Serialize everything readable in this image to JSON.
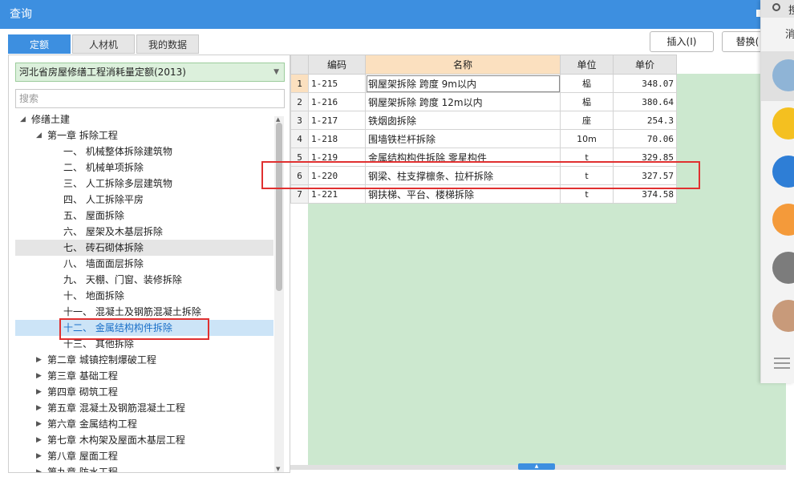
{
  "window": {
    "title": "查询"
  },
  "tabs": [
    {
      "label": "定额",
      "active": true
    },
    {
      "label": "人材机",
      "active": false
    },
    {
      "label": "我的数据",
      "active": false
    }
  ],
  "toolbar": {
    "insert_label": "插入(I)",
    "replace_label": "替换("
  },
  "left": {
    "library_select": "河北省房屋修缮工程消耗量定额(2013)",
    "search_placeholder": "搜索",
    "tree": [
      {
        "label": "修缮土建",
        "caret": "◢"
      },
      {
        "label": "第一章 拆除工程",
        "caret": "◢"
      },
      {
        "label": "一、  机械整体拆除建筑物",
        "caret": ""
      },
      {
        "label": "二、  机械单项拆除",
        "caret": ""
      },
      {
        "label": "三、  人工拆除多层建筑物",
        "caret": ""
      },
      {
        "label": "四、  人工拆除平房",
        "caret": ""
      },
      {
        "label": "五、  屋面拆除",
        "caret": ""
      },
      {
        "label": "六、  屋架及木基层拆除",
        "caret": ""
      },
      {
        "label": "七、  砖石砌体拆除",
        "caret": ""
      },
      {
        "label": "八、  墙面面层拆除",
        "caret": ""
      },
      {
        "label": "九、  天棚、门窗、装修拆除",
        "caret": ""
      },
      {
        "label": "十、  地面拆除",
        "caret": ""
      },
      {
        "label": "十一、  混凝土及钢筋混凝土拆除",
        "caret": ""
      },
      {
        "label": "十二、  金属结构构件拆除",
        "caret": ""
      },
      {
        "label": "十三、  其他拆除",
        "caret": ""
      },
      {
        "label": "第二章 城镇控制爆破工程",
        "caret": "▶"
      },
      {
        "label": "第三章 基础工程",
        "caret": "▶"
      },
      {
        "label": "第四章 砌筑工程",
        "caret": "▶"
      },
      {
        "label": "第五章 混凝土及钢筋混凝土工程",
        "caret": "▶"
      },
      {
        "label": "第六章 金属结构工程",
        "caret": "▶"
      },
      {
        "label": "第七章 木构架及屋面木基层工程",
        "caret": "▶"
      },
      {
        "label": "第八章 屋面工程",
        "caret": "▶"
      },
      {
        "label": "第九章 防水工程",
        "caret": "▶"
      }
    ]
  },
  "grid": {
    "headers": {
      "code": "编码",
      "name": "名称",
      "unit": "单位",
      "price": "单价"
    },
    "rows": [
      {
        "no": "1",
        "code": "1-215",
        "name": "钢屋架拆除 跨度 9m以内",
        "unit": "榀",
        "price": "348.07"
      },
      {
        "no": "2",
        "code": "1-216",
        "name": "钢屋架拆除 跨度 12m以内",
        "unit": "榀",
        "price": "380.64"
      },
      {
        "no": "3",
        "code": "1-217",
        "name": "铁烟囱拆除",
        "unit": "座",
        "price": "254.3"
      },
      {
        "no": "4",
        "code": "1-218",
        "name": "围墙铁栏杆拆除",
        "unit": "10m",
        "price": "70.06"
      },
      {
        "no": "5",
        "code": "1-219",
        "name": "金属结构构件拆除 零星构件",
        "unit": "t",
        "price": "329.85"
      },
      {
        "no": "6",
        "code": "1-220",
        "name": "钢梁、柱支撑檩条、拉杆拆除",
        "unit": "t",
        "price": "327.57"
      },
      {
        "no": "7",
        "code": "1-221",
        "name": "钢扶梯、平台、楼梯拆除",
        "unit": "t",
        "price": "374.58"
      }
    ]
  },
  "side": {
    "search_text": "搜",
    "tab_text": "消"
  },
  "colors": {
    "accent": "#3d8fe0",
    "highlight": "#e03030",
    "grid_bg": "#cce8cf"
  }
}
